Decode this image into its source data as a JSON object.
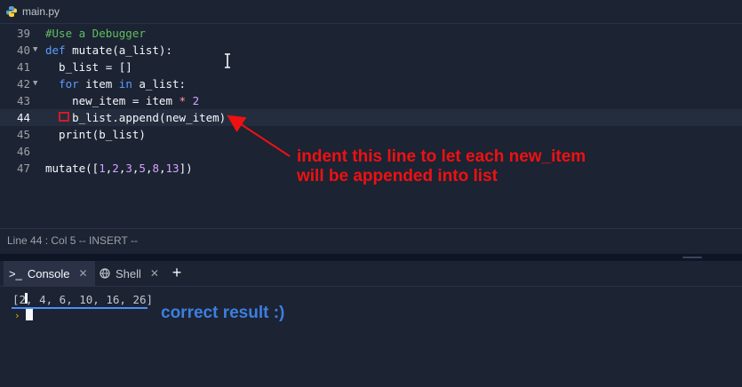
{
  "editor": {
    "file_tab": "main.py",
    "lines": [
      {
        "n": "39",
        "parts": [
          [
            "com",
            "#Use a Debugger"
          ]
        ]
      },
      {
        "n": "40",
        "fold": true,
        "parts": [
          [
            "kw",
            "def"
          ],
          [
            "",
            " mutate(a_list):"
          ]
        ]
      },
      {
        "n": "41",
        "parts": [
          [
            "",
            "  b_list = []"
          ]
        ]
      },
      {
        "n": "42",
        "fold": true,
        "parts": [
          [
            "",
            "  "
          ],
          [
            "kw",
            "for"
          ],
          [
            "",
            " item "
          ],
          [
            "kw",
            "in"
          ],
          [
            "",
            " a_list:"
          ]
        ]
      },
      {
        "n": "43",
        "parts": [
          [
            "",
            "    new_item = item "
          ],
          [
            "op",
            "*"
          ],
          [
            "",
            " "
          ],
          [
            "num",
            "2"
          ]
        ]
      },
      {
        "n": "44",
        "active": true,
        "parts": [
          [
            "",
            "  "
          ],
          [
            "",
            "  b_list.append(new_item)"
          ]
        ]
      },
      {
        "n": "45",
        "parts": [
          [
            "",
            "  print(b_list)"
          ]
        ]
      },
      {
        "n": "46",
        "parts": [
          [
            "",
            ""
          ]
        ]
      },
      {
        "n": "47",
        "parts": [
          [
            "",
            "mutate(["
          ],
          [
            "num",
            "1"
          ],
          [
            "",
            ","
          ],
          [
            "num",
            "2"
          ],
          [
            "",
            ","
          ],
          [
            "num",
            "3"
          ],
          [
            "",
            ","
          ],
          [
            "num",
            "5"
          ],
          [
            "",
            ","
          ],
          [
            "num",
            "8"
          ],
          [
            "",
            ","
          ],
          [
            "num",
            "13"
          ],
          [
            "",
            "])"
          ]
        ]
      }
    ],
    "status": "Line 44 : Col 5  -- INSERT --"
  },
  "console": {
    "tabs": [
      {
        "label": "Console",
        "icon": "terminal-icon"
      },
      {
        "label": "Shell",
        "icon": "shell-icon"
      }
    ],
    "output": "[2, 4, 6, 10, 16, 26]",
    "prompt": "›"
  },
  "annotations": {
    "red_note": "indent this line to let each new_item\nwill be appended into list",
    "blue_note": "correct result :)",
    "red_color": "#ee1111",
    "blue_color": "#3c7fe0"
  }
}
